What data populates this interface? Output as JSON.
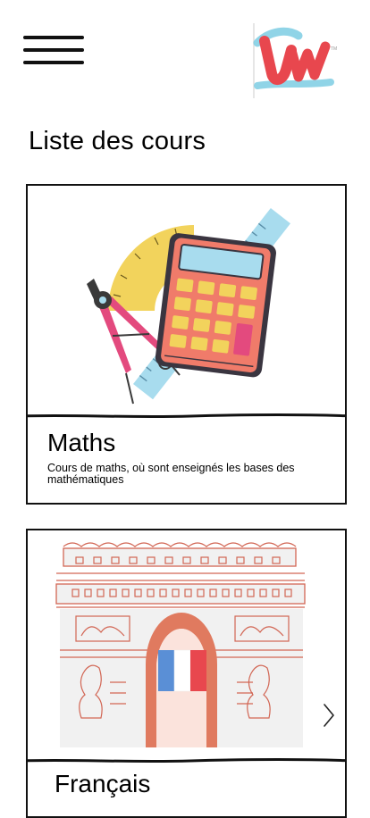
{
  "header": {
    "menu_icon": "hamburger-menu-icon",
    "logo": "app-logo"
  },
  "page": {
    "title": "Liste des cours"
  },
  "courses": [
    {
      "title": "Maths",
      "description": "Cours de maths, où sont enseignés les bases des mathématiques",
      "illustration": "calculator-compass-ruler-illustration"
    },
    {
      "title": "Français",
      "illustration": "arc-de-triomphe-french-flag-illustration"
    }
  ],
  "carousel": {
    "next_icon": "chevron-right-icon"
  },
  "colors": {
    "accent_red": "#e8474e",
    "accent_blue": "#7ccde3",
    "accent_yellow": "#f2d35c",
    "calculator": "#f07b6a"
  }
}
